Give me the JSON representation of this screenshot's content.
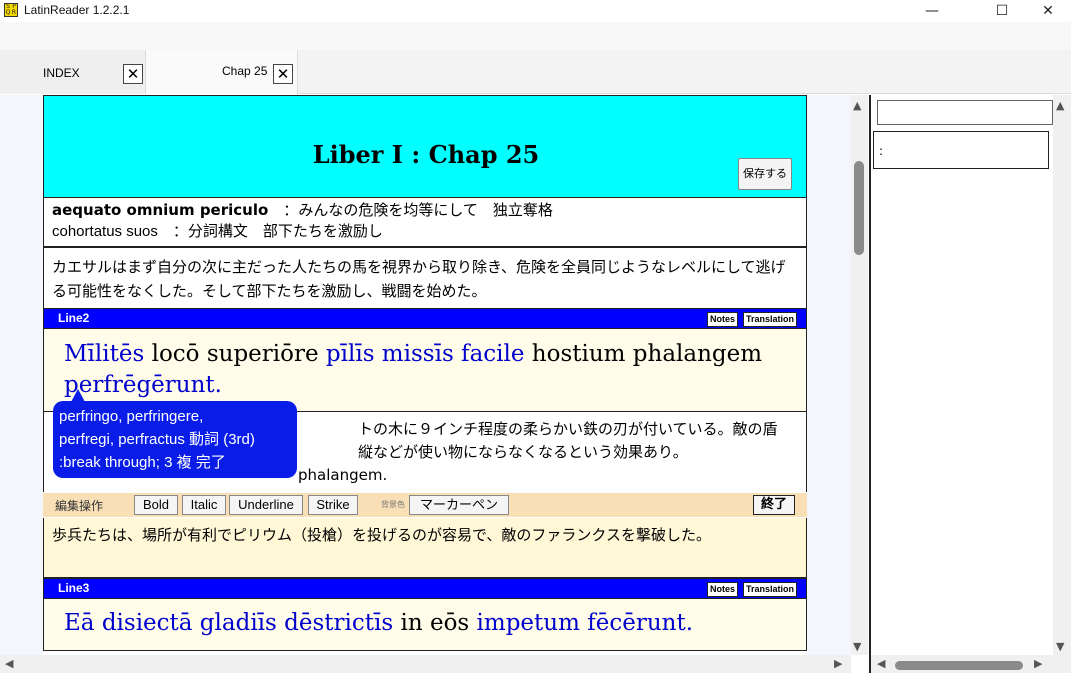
{
  "window": {
    "title": "LatinReader 1.2.2.1",
    "icon_text": "SPQR",
    "minimize": "—",
    "maximize": "☐",
    "close": "✕"
  },
  "tabs": [
    {
      "label": "INDEX",
      "close": "✕"
    },
    {
      "label": "Chap 25",
      "close": "✕"
    }
  ],
  "header": {
    "title": "Liber I : Chap 25",
    "save_label": "保存する"
  },
  "notes1": {
    "lines": [
      {
        "term": "aequato omnium periculo",
        "sep": "　：",
        "desc": "みんなの危険を均等にして　独立奪格"
      },
      {
        "term": "cohortatus suos",
        "sep": "　：",
        "desc": "分詞構文　部下たちを激励し"
      }
    ]
  },
  "translation1": "カエサルはまず自分の次に主だった人たちの馬を視界から取り除き、危険を全員同じようなレベルにして逃げる可能性をなくした。そして部下たちを激励し、戦闘を始めた。",
  "line2": {
    "label": "Line2",
    "notes_btn": "Notes",
    "translation_btn": "Translation",
    "words": [
      {
        "t": "Mīlitēs",
        "hl": true
      },
      {
        "t": " locō superiōre ",
        "hl": false
      },
      {
        "t": "pīlīs missīs facile",
        "hl": true
      },
      {
        "t": " hostium phalangem ",
        "hl": false
      },
      {
        "t": "perfrēgērunt.",
        "hl": true
      }
    ]
  },
  "notes2": {
    "visible_line1": "トの木に９インチ程度の柔らかい鉄の刃が付いている。敵の盾",
    "visible_line2": "縦などが使い物にならなくなるという効果あり。",
    "visible_line3": "phalangem."
  },
  "tooltip": {
    "line1": "perfringo, perfringere,",
    "line2": "perfregi, perfractus 動詞 (3rd)",
    "line3": ":break through; 3 複 完了"
  },
  "edit_bar": {
    "label": "編集操作",
    "bold": "Bold",
    "italic": "Italic",
    "underline": "Underline",
    "strike": "Strike",
    "bg_label": "背景色",
    "marker": "マーカーペン",
    "end": "終了"
  },
  "translation2": "歩兵たちは、場所が有利でピリウム（投槍）を投げるのが容易で、敵のファランクスを撃破した。",
  "line3": {
    "label": "Line3",
    "notes_btn": "Notes",
    "translation_btn": "Translation",
    "words": [
      {
        "t": "Eā disiectā gladiīs dēstrictīs",
        "hl": true
      },
      {
        "t": " in eōs ",
        "hl": false
      },
      {
        "t": "impetum fēcērunt.",
        "hl": true
      }
    ]
  },
  "side_panel": {
    "search_value": "",
    "detail_text": ":"
  }
}
